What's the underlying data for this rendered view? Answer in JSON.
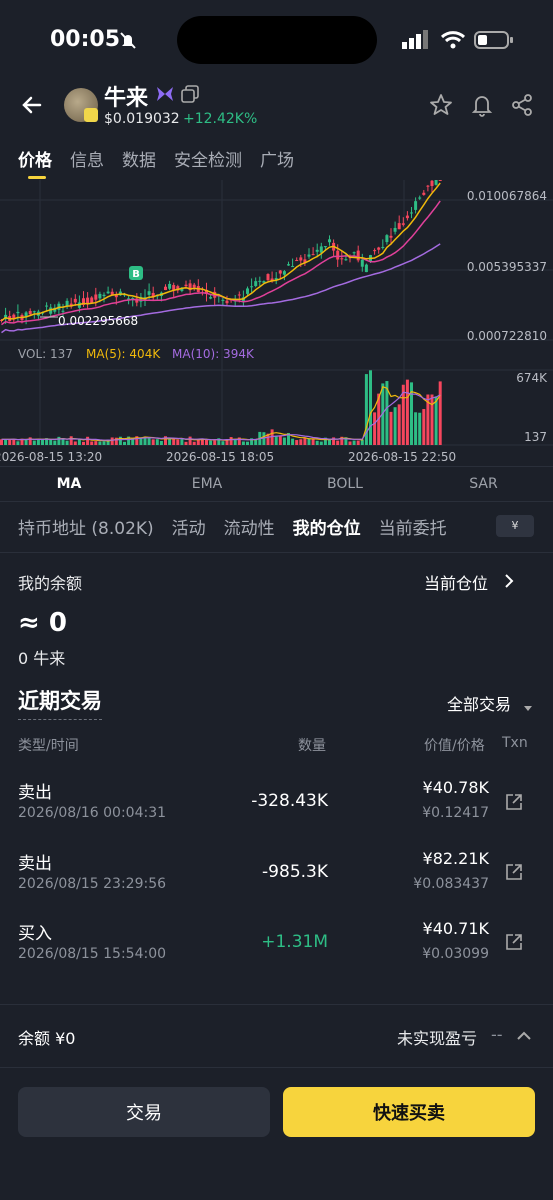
{
  "status_bar": {
    "time": "00:05"
  },
  "header": {
    "token_name": "牛来",
    "price": "$0.019032",
    "change": "+12.42K%"
  },
  "main_tabs": [
    "价格",
    "信息",
    "数据",
    "安全检测",
    "广场"
  ],
  "chart_data": {
    "type": "line",
    "price_axis_labels": [
      "0.010067864",
      "0.005395337",
      "0.000722810"
    ],
    "low_marker": "0.002295668",
    "buy_marker": "B",
    "volume_legend": {
      "vol": "VOL: 137",
      "ma5": "MA(5): 404K",
      "ma10": "MA(10): 394K"
    },
    "volume_axis_labels": [
      "674K",
      "137"
    ],
    "time_labels": [
      "2026-08-15 13:20",
      "2026-08-15 18:05",
      "2026-08-15 22:50"
    ],
    "colors": {
      "up": "#2ebd85",
      "down": "#f6465d",
      "ma5": "#f0b90b",
      "ma10": "#e0409a",
      "ma30": "#a46be0"
    }
  },
  "indicator_tabs": [
    "MA",
    "EMA",
    "BOLL",
    "SAR"
  ],
  "section_tabs": [
    "持币地址 (8.02K)",
    "活动",
    "流动性",
    "我的仓位",
    "当前委托"
  ],
  "currency_symbol": "¥",
  "balance": {
    "label": "我的余额",
    "current_position": "当前仓位",
    "approx_value": "≈ 0",
    "token_amount": "0 牛来"
  },
  "recent": {
    "title": "近期交易",
    "filter": "全部交易",
    "headers": {
      "type_time": "类型/时间",
      "qty": "数量",
      "value_price": "价值/价格",
      "txn": "Txn"
    },
    "rows": [
      {
        "type": "卖出",
        "time": "2026/08/16 00:04:31",
        "qty": "-328.43K",
        "value": "¥40.78K",
        "price": "¥0.12417"
      },
      {
        "type": "卖出",
        "time": "2026/08/15 23:29:56",
        "qty": "-985.3K",
        "value": "¥82.21K",
        "price": "¥0.083437"
      },
      {
        "type": "买入",
        "time": "2026/08/15 15:54:00",
        "qty": "+1.31M",
        "value": "¥40.71K",
        "price": "¥0.03099"
      }
    ]
  },
  "footer": {
    "balance": "余额 ¥0",
    "pnl_label": "未实现盈亏",
    "pnl_value": "--"
  },
  "buttons": {
    "trade": "交易",
    "quick": "快速买卖"
  }
}
